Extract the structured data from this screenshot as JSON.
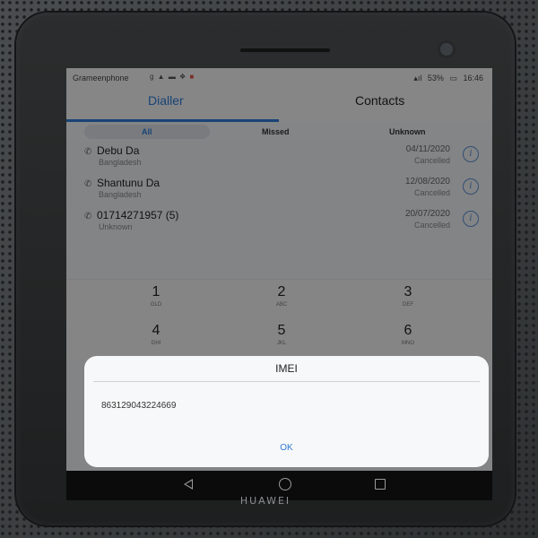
{
  "status_bar": {
    "carrier": "Grameenphone",
    "battery": "53%",
    "time": "16:46"
  },
  "tabs": [
    {
      "label": "Dialler",
      "active": true
    },
    {
      "label": "Contacts",
      "active": false
    }
  ],
  "filters": [
    "All",
    "Missed",
    "Unknown"
  ],
  "call_log": [
    {
      "name": "Debu Da",
      "sub": "Bangladesh",
      "date": "04/11/2020",
      "status": "Cancelled"
    },
    {
      "name": "Shantunu Da",
      "sub": "Bangladesh",
      "date": "12/08/2020",
      "status": "Cancelled"
    },
    {
      "name": "01714271957 (5)",
      "sub": "Unknown",
      "date": "20/07/2020",
      "status": "Cancelled"
    }
  ],
  "keypad": [
    {
      "num": "1",
      "letters": "GLD"
    },
    {
      "num": "2",
      "letters": "ABC"
    },
    {
      "num": "3",
      "letters": "DEF"
    },
    {
      "num": "4",
      "letters": "GHI"
    },
    {
      "num": "5",
      "letters": "JKL"
    },
    {
      "num": "6",
      "letters": "MNO"
    }
  ],
  "dialog": {
    "title": "IMEI",
    "value": "863129043224669",
    "ok_label": "OK"
  },
  "device_brand": "HUAWEI",
  "colors": {
    "accent": "#2f7bd6",
    "dialog_bg": "#f7f8f9"
  },
  "icons": [
    "phone-icon",
    "info-icon",
    "back-icon",
    "home-icon",
    "recent-apps-icon"
  ]
}
